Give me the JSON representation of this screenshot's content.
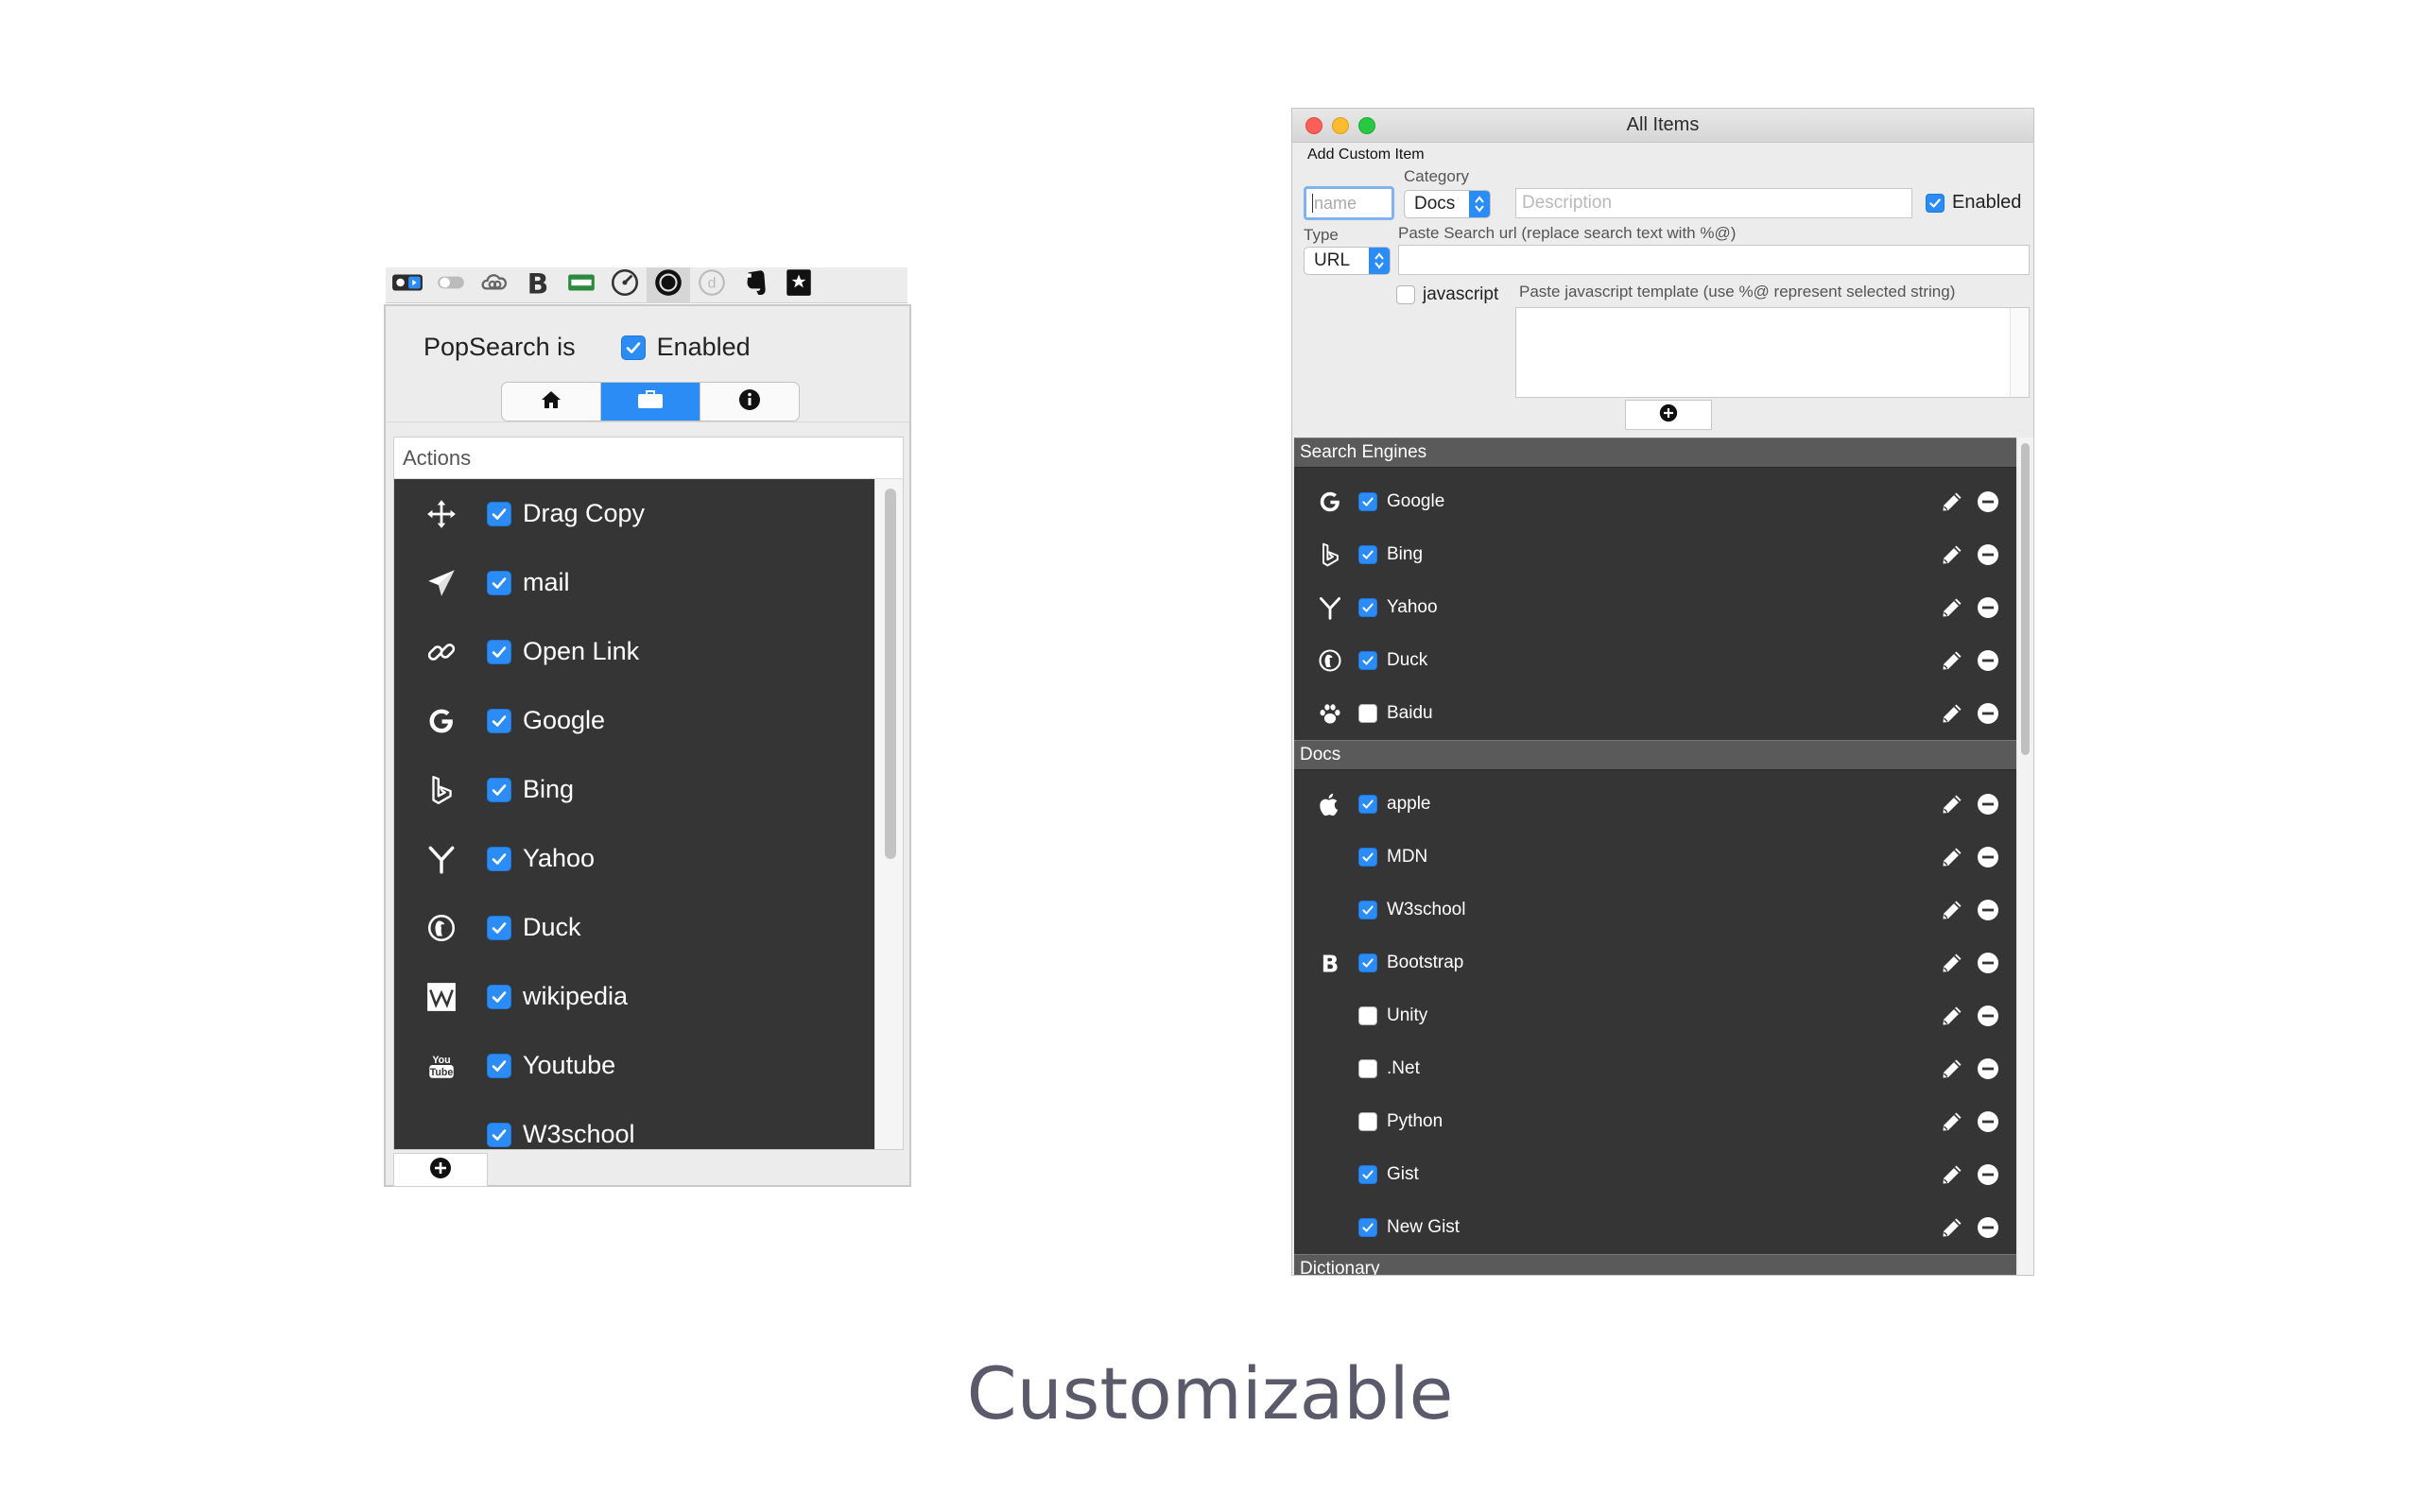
{
  "caption": "Customizable",
  "colors": {
    "accent": "#2c8cf6",
    "list_bg": "#353535",
    "group_header": "#5a5a5a"
  },
  "menubar": {
    "icons": [
      "switch-toggle-icon",
      "toggle-icon",
      "creative-cloud-icon",
      "bootstrap-b-icon",
      "battery-flag-icon",
      "speed-gauge-icon",
      "popsearch-icon",
      "d-icon",
      "evernote-icon",
      "bookmark-icon"
    ]
  },
  "popover": {
    "status_label": "PopSearch is",
    "enabled_label": "Enabled",
    "enabled": true,
    "tabs": [
      {
        "name": "home",
        "icon": "home-icon",
        "selected": false
      },
      {
        "name": "actions",
        "icon": "toolbox-icon",
        "selected": true
      },
      {
        "name": "info",
        "icon": "info-icon",
        "selected": false
      }
    ],
    "list_header": "Actions",
    "actions": [
      {
        "label": "Drag Copy",
        "icon": "move-arrows-icon",
        "checked": true
      },
      {
        "label": "mail",
        "icon": "paper-plane-icon",
        "checked": true
      },
      {
        "label": "Open Link",
        "icon": "link-icon",
        "checked": true
      },
      {
        "label": "Google",
        "icon": "google-icon",
        "checked": true
      },
      {
        "label": "Bing",
        "icon": "bing-icon",
        "checked": true
      },
      {
        "label": "Yahoo",
        "icon": "yahoo-icon",
        "checked": true
      },
      {
        "label": "Duck",
        "icon": "duckduckgo-icon",
        "checked": true
      },
      {
        "label": "wikipedia",
        "icon": "wikipedia-icon",
        "checked": true
      },
      {
        "label": "Youtube",
        "icon": "youtube-icon",
        "checked": true
      },
      {
        "label": "W3school",
        "icon": "",
        "checked": true
      }
    ]
  },
  "window": {
    "title": "All Items",
    "section_label": "Add Custom Item",
    "category_label": "Category",
    "type_label": "Type",
    "name_placeholder": "name",
    "category_value": "Docs",
    "description_placeholder": "Description",
    "enabled_label": "Enabled",
    "enabled": true,
    "type_value": "URL",
    "url_label": "Paste Search url (replace search text with %@)",
    "javascript_label": "javascript",
    "javascript_checked": false,
    "js_template_label": "Paste javascript template (use %@ represent selected string)",
    "groups": [
      {
        "title": "Search Engines",
        "items": [
          {
            "label": "Google",
            "icon": "google-icon",
            "checked": true
          },
          {
            "label": "Bing",
            "icon": "bing-icon",
            "checked": true
          },
          {
            "label": "Yahoo",
            "icon": "yahoo-icon",
            "checked": true
          },
          {
            "label": "Duck",
            "icon": "duckduckgo-icon",
            "checked": true
          },
          {
            "label": "Baidu",
            "icon": "paw-icon",
            "checked": false
          }
        ]
      },
      {
        "title": "Docs",
        "items": [
          {
            "label": "apple",
            "icon": "apple-icon",
            "checked": true
          },
          {
            "label": "MDN",
            "icon": "",
            "checked": true
          },
          {
            "label": "W3school",
            "icon": "",
            "checked": true
          },
          {
            "label": "Bootstrap",
            "icon": "bootstrap-b-icon",
            "checked": true
          },
          {
            "label": "Unity",
            "icon": "",
            "checked": false
          },
          {
            "label": ".Net",
            "icon": "",
            "checked": false
          },
          {
            "label": "Python",
            "icon": "",
            "checked": false
          },
          {
            "label": "Gist",
            "icon": "",
            "checked": true
          },
          {
            "label": "New Gist",
            "icon": "",
            "checked": true
          }
        ]
      },
      {
        "title": "Dictionary",
        "items": []
      }
    ]
  }
}
